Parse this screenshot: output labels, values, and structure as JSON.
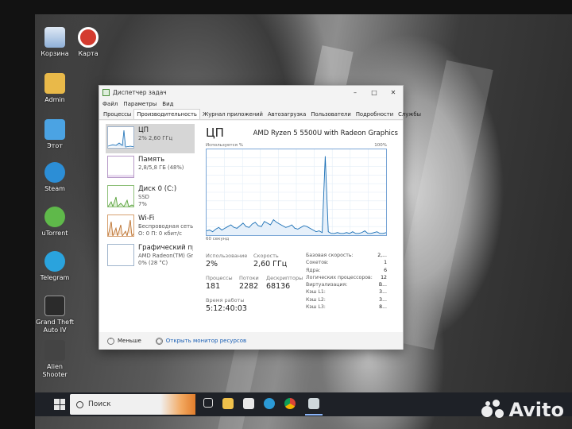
{
  "desktop": {
    "icons": [
      {
        "label": "Корзина"
      },
      {
        "label": "Карта"
      },
      {
        "label": "Admin"
      },
      {
        "label": "Этот"
      },
      {
        "label": "Steam"
      },
      {
        "label": "uTorrent"
      },
      {
        "label": "Telegram"
      },
      {
        "label": "Grand Theft Auto IV"
      },
      {
        "label": "Alien Shooter"
      }
    ]
  },
  "window": {
    "title": "Диспетчер задач",
    "menu": [
      "Файл",
      "Параметры",
      "Вид"
    ],
    "tabs": [
      "Процессы",
      "Производительность",
      "Журнал приложений",
      "Автозагрузка",
      "Пользователи",
      "Подробности",
      "Службы"
    ],
    "active_tab": "Производительность"
  },
  "sidebar": {
    "items": [
      {
        "name": "ЦП",
        "line1": "2% 2,60 ГГц",
        "line2": "",
        "color": "#1a6fb5"
      },
      {
        "name": "Память",
        "line1": "2,8/5,8 ГБ (48%)",
        "line2": "",
        "color": "#8b4da8"
      },
      {
        "name": "Диск 0 (C:)",
        "line1": "SSD",
        "line2": "7%",
        "color": "#4d9a2e"
      },
      {
        "name": "Wi-Fi",
        "line1": "Беспроводная сеть",
        "line2": "О: 0 П: 0 кбит/с",
        "color": "#b5651d"
      },
      {
        "name": "Графический про",
        "line1": "AMD Radeon(TM) Grap",
        "line2": "0% (28 °C)",
        "color": "#1a6fb5"
      }
    ]
  },
  "cpu": {
    "title": "ЦП",
    "model": "AMD Ryzen 5 5500U with Radeon Graphics",
    "graph_label": "Используется %",
    "graph_max": "100%",
    "graph_time": "60 секунд",
    "utilization_label": "Использование",
    "utilization": "2%",
    "speed_label": "Скорость",
    "speed": "2,60 ГГц",
    "processes_label": "Процессы",
    "processes": "181",
    "threads_label": "Потоки",
    "threads": "2282",
    "handles_label": "Дескрипторы",
    "handles": "68136",
    "uptime_label": "Время работы",
    "uptime": "5:12:40:03",
    "specs": [
      {
        "k": "Базовая скорость:",
        "v": "2,..."
      },
      {
        "k": "Сокетов:",
        "v": "1"
      },
      {
        "k": "Ядра:",
        "v": "6"
      },
      {
        "k": "Логических процессоров:",
        "v": "12"
      },
      {
        "k": "Виртуализация:",
        "v": "В..."
      },
      {
        "k": "Кэш L1:",
        "v": "3..."
      },
      {
        "k": "Кэш L2:",
        "v": "3..."
      },
      {
        "k": "Кэш L3:",
        "v": "8..."
      }
    ],
    "usage_history": [
      5,
      6,
      4,
      7,
      9,
      6,
      8,
      10,
      12,
      9,
      8,
      11,
      14,
      10,
      9,
      13,
      15,
      11,
      10,
      16,
      14,
      12,
      18,
      15,
      13,
      11,
      9,
      10,
      12,
      8,
      7,
      9,
      11,
      10,
      8,
      6,
      4,
      5,
      3,
      92,
      4,
      2,
      2,
      3,
      2,
      2,
      3,
      2,
      4,
      2,
      2,
      3,
      5,
      2,
      2,
      3,
      4,
      2,
      2,
      3
    ]
  },
  "footer": {
    "less": "Меньше",
    "monitor": "Открыть монитор ресурсов"
  },
  "taskbar": {
    "search": "Поиск"
  },
  "watermark": "Avito"
}
